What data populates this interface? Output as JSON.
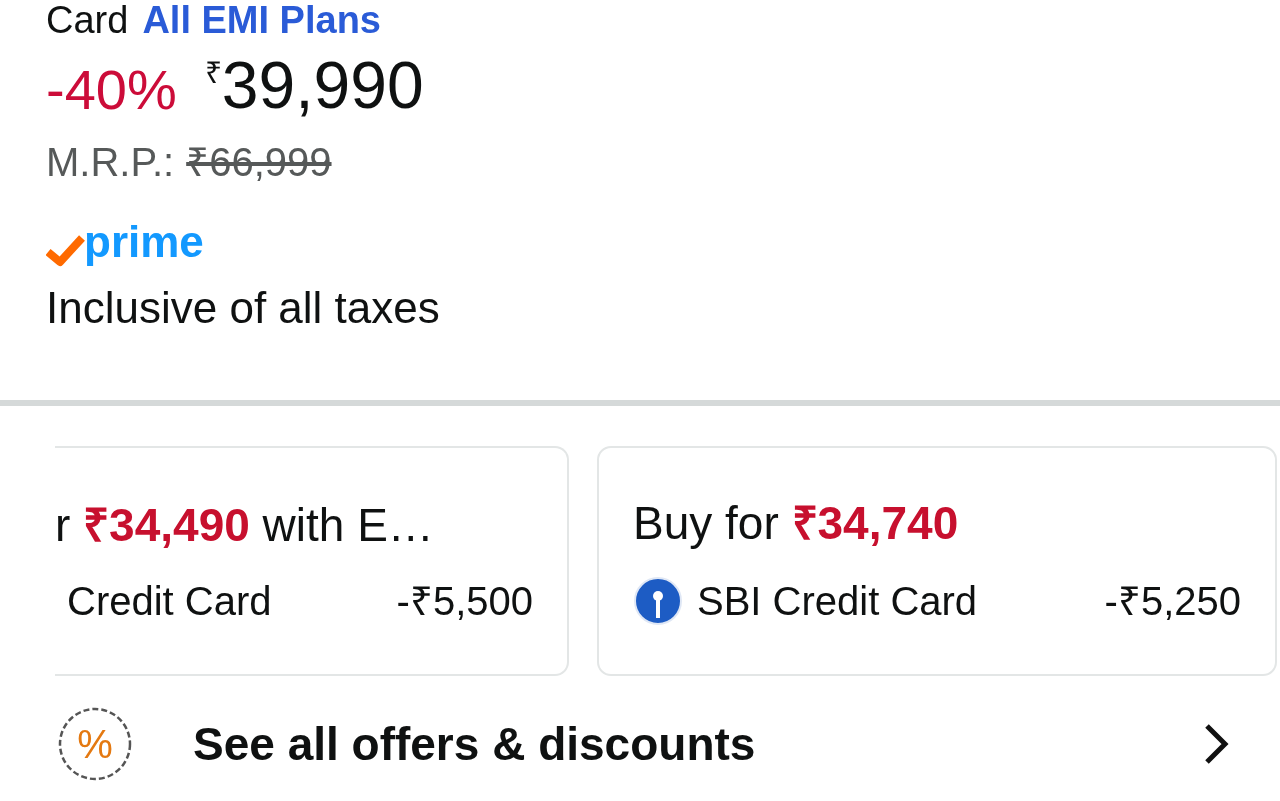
{
  "emi": {
    "label": "Card",
    "link": "All EMI Plans"
  },
  "price": {
    "discount": "-40%",
    "currency": "₹",
    "amount": "39,990",
    "mrp_label": "M.R.P.:",
    "mrp": "₹66,999"
  },
  "prime": {
    "label": "prime"
  },
  "tax_note": "Inclusive of all taxes",
  "offers": [
    {
      "title": "r **₹34,490** with E…",
      "bank": "Credit Card",
      "saving": "-₹5,500",
      "bank_icon": false
    },
    {
      "title": "Buy for **₹34,740**",
      "bank": "SBI Credit Card",
      "saving": "-₹5,250",
      "bank_icon": true
    }
  ],
  "see_all": {
    "label": "See all offers & discounts",
    "icon": "%"
  }
}
